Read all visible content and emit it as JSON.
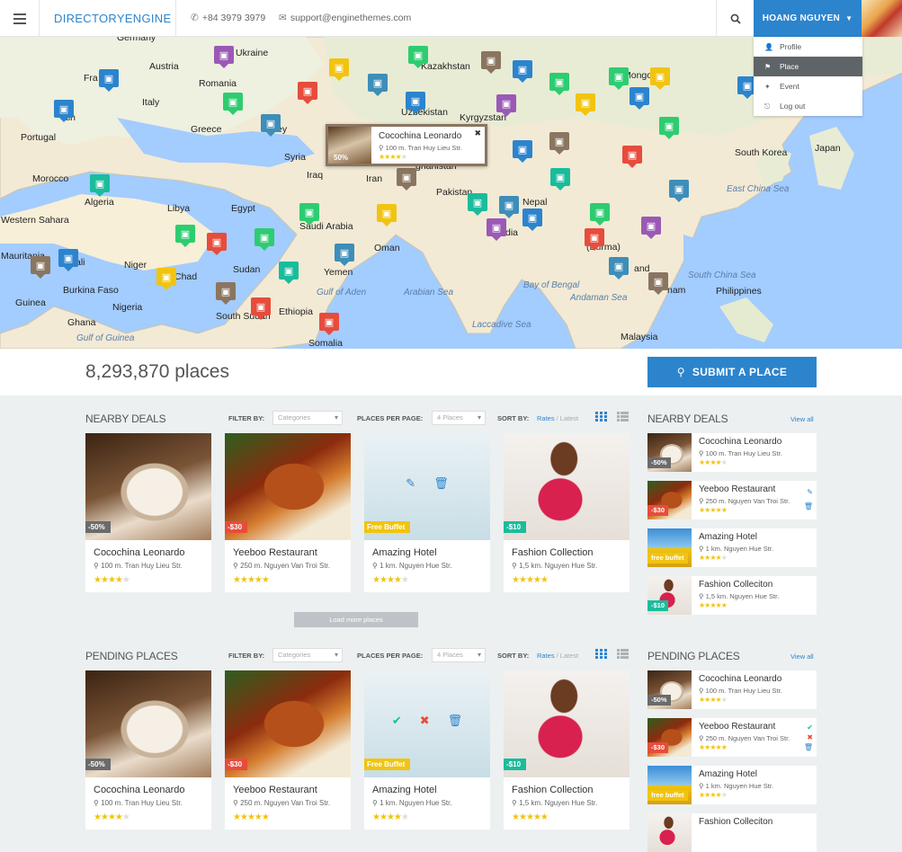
{
  "header": {
    "logo_light": "DIRECTORY",
    "logo_bold": "ENGINE",
    "phone": "+84 3979 3979",
    "email": "support@enginethemes.com",
    "user": "HOANG NGUYEN",
    "menu": [
      {
        "label": "Profile",
        "icon": "user-icon"
      },
      {
        "label": "Place",
        "icon": "place-icon"
      },
      {
        "label": "Event",
        "icon": "event-icon"
      },
      {
        "label": "Log out",
        "icon": "logout-icon"
      }
    ],
    "active_menu": "Place"
  },
  "map": {
    "labels": [
      "Germany",
      "Ukraine",
      "Austria",
      "Kazakhstan",
      "Fra",
      "Romania",
      "Mongoli",
      "ain",
      "Italy",
      "Uzbekistan",
      "Kyrgyzstan",
      "Portugal",
      "Greece",
      "ey",
      "Syria",
      "Japan",
      "South Korea",
      "Iraq",
      "Iran",
      "ghanistan",
      "Morocco",
      "Algeria",
      "Pakistan",
      "Nepal",
      "East China Sea",
      "Libya",
      "Egypt",
      "Saudi Arabia",
      "dia",
      "Western Sahara",
      "Oman",
      "Mauritania",
      "ali",
      "Niger",
      "Chad",
      "Sudan",
      "Yemen",
      "(Burma)",
      "and",
      "Burkina Faso",
      "Guinea",
      "Ghana",
      "Nigeria",
      "South Sudan",
      "Ethiopia",
      "Gulf of Aden",
      "Arabian Sea",
      "Bay of Bengal",
      "Andaman Sea",
      "nam",
      "South China Sea",
      "Philippines",
      "Gulf of Guinea",
      "Somalia",
      "Laccadive Sea",
      "Malaysia"
    ],
    "popup": {
      "name": "Cocochina Leonardo",
      "address": "100 m. Tran Huy Lieu Str.",
      "badge": "50%",
      "rating": 4
    }
  },
  "stats": {
    "count": "8,293,870 places",
    "submit": "SUBMIT A PLACE"
  },
  "filters": {
    "filter_by": "FILTER BY:",
    "category": "Categories",
    "per_page": "PLACES PER PAGE:",
    "per_page_value": "4 Places",
    "sort_by": "SORT BY:",
    "rates": "Rates",
    "sep": "/",
    "latest": "Latest"
  },
  "nearby": {
    "title": "NEARBY DEALS",
    "load_more": "Load more places",
    "cards": [
      {
        "name": "Cocochina Leonardo",
        "address": "100 m. Tran Huy Lieu Str.",
        "badge": "-50%",
        "badge_color": "#6b6b6b",
        "rating": 4
      },
      {
        "name": "Yeeboo Restaurant",
        "address": "250 m. Nguyen Van Troi Str.",
        "badge": "-$30",
        "badge_color": "#e74c3c",
        "rating": 5
      },
      {
        "name": "Amazing Hotel",
        "address": "1 km. Nguyen Hue Str.",
        "badge": "Free Buffet",
        "badge_color": "#f1c40f",
        "rating": 4
      },
      {
        "name": "Fashion Collection",
        "address": "1,5 km. Nguyen Hue Str.",
        "badge": "-$10",
        "badge_color": "#1abc9c",
        "rating": 5
      }
    ]
  },
  "sidebar_nearby": {
    "title": "NEARBY DEALS",
    "view_all": "View all",
    "items": [
      {
        "name": "Cocochina Leonardo",
        "address": "100 m. Tran Huy Lieu Str.",
        "badge": "-50%",
        "badge_color": "#6b6b6b",
        "rating": 4
      },
      {
        "name": "Yeeboo Restaurant",
        "address": "250 m. Nguyen Van Troi Str.",
        "badge": "-$30",
        "badge_color": "#e74c3c",
        "rating": 5
      },
      {
        "name": "Amazing Hotel",
        "address": "1 km. Nguyen Hue Str.",
        "badge": "free buffet",
        "badge_color": "#f1c40f",
        "rating": 4
      },
      {
        "name": "Fashion Colleciton",
        "address": "1,5 km. Nguyen Hue Str.",
        "badge": "-$10",
        "badge_color": "#1abc9c",
        "rating": 5
      }
    ]
  },
  "pending": {
    "title": "PENDING PLACES",
    "cards": [
      {
        "name": "Cocochina Leonardo",
        "address": "100 m. Tran Huy Lieu Str.",
        "badge": "-50%",
        "badge_color": "#6b6b6b",
        "rating": 4
      },
      {
        "name": "Yeeboo Restaurant",
        "address": "250 m. Nguyen Van Troi Str.",
        "badge": "-$30",
        "badge_color": "#e74c3c",
        "rating": 5
      },
      {
        "name": "Amazing Hotel",
        "address": "1 km. Nguyen Hue Str.",
        "badge": "Free Buffet",
        "badge_color": "#f1c40f",
        "rating": 4
      },
      {
        "name": "Fashion Collection",
        "address": "1,5 km. Nguyen Hue Str.",
        "badge": "-$10",
        "badge_color": "#1abc9c",
        "rating": 5
      }
    ]
  },
  "sidebar_pending": {
    "title": "PENDING PLACES",
    "view_all": "View all",
    "items": [
      {
        "name": "Cocochina Leonardo",
        "address": "100 m. Tran Huy Lieu Str.",
        "badge": "-50%",
        "badge_color": "#6b6b6b",
        "rating": 4
      },
      {
        "name": "Yeeboo Restaurant",
        "address": "250 m. Nguyen Van Troi Str.",
        "badge": "-$30",
        "badge_color": "#e74c3c",
        "rating": 5
      },
      {
        "name": "Amazing Hotel",
        "address": "1 km. Nguyen Hue Str.",
        "badge": "free buffet",
        "badge_color": "#f1c40f",
        "rating": 4
      },
      {
        "name": "Fashion Colleciton",
        "address": "",
        "badge": "",
        "badge_color": "#1abc9c",
        "rating": 0
      }
    ]
  },
  "colors": {
    "accent": "#2c84cd",
    "pin_colors": [
      "#2c84cd",
      "#2ecc71",
      "#9b59b6",
      "#f1c40f",
      "#e74c3c",
      "#1abc9c",
      "#8a7560",
      "#3d8eb9",
      "#7f8c8d"
    ]
  }
}
